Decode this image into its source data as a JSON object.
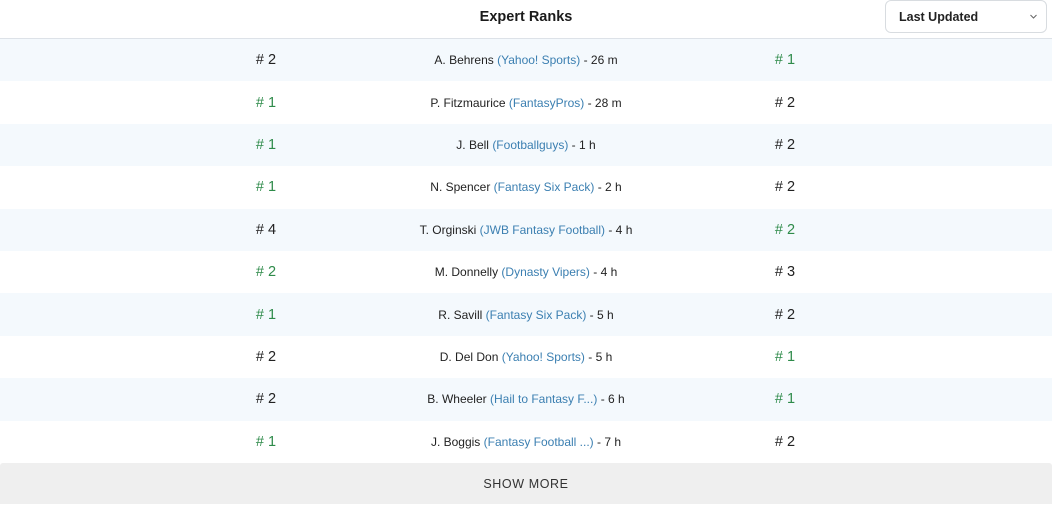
{
  "header": {
    "title": "Expert Ranks",
    "sort_select": {
      "selected": "Last Updated"
    }
  },
  "colors": {
    "accent_green": "#2e8b4a",
    "link_blue": "#3b7fb1",
    "row_alt": "#f4f9fd"
  },
  "rows": [
    {
      "left_rank": "# 2",
      "left_best": false,
      "expert": "A. Behrens",
      "source": "(Yahoo! Sports)",
      "time": " - 26 m",
      "right_rank": "# 1",
      "right_best": true
    },
    {
      "left_rank": "# 1",
      "left_best": true,
      "expert": "P. Fitzmaurice",
      "source": "(FantasyPros)",
      "time": " - 28 m",
      "right_rank": "# 2",
      "right_best": false
    },
    {
      "left_rank": "# 1",
      "left_best": true,
      "expert": "J. Bell",
      "source": "(Footballguys)",
      "time": " - 1 h",
      "right_rank": "# 2",
      "right_best": false
    },
    {
      "left_rank": "# 1",
      "left_best": true,
      "expert": "N. Spencer",
      "source": "(Fantasy Six Pack)",
      "time": " - 2 h",
      "right_rank": "# 2",
      "right_best": false
    },
    {
      "left_rank": "# 4",
      "left_best": false,
      "expert": "T. Orginski",
      "source": "(JWB Fantasy Football)",
      "time": " - 4 h",
      "right_rank": "# 2",
      "right_best": true
    },
    {
      "left_rank": "# 2",
      "left_best": true,
      "expert": "M. Donnelly",
      "source": "(Dynasty Vipers)",
      "time": " - 4 h",
      "right_rank": "# 3",
      "right_best": false
    },
    {
      "left_rank": "# 1",
      "left_best": true,
      "expert": "R. Savill",
      "source": "(Fantasy Six Pack)",
      "time": " - 5 h",
      "right_rank": "# 2",
      "right_best": false
    },
    {
      "left_rank": "# 2",
      "left_best": false,
      "expert": "D. Del Don",
      "source": "(Yahoo! Sports)",
      "time": " - 5 h",
      "right_rank": "# 1",
      "right_best": true
    },
    {
      "left_rank": "# 2",
      "left_best": false,
      "expert": "B. Wheeler",
      "source": "(Hail to Fantasy F...)",
      "time": " - 6 h",
      "right_rank": "# 1",
      "right_best": true
    },
    {
      "left_rank": "# 1",
      "left_best": true,
      "expert": "J. Boggis",
      "source": "(Fantasy Football ...)",
      "time": " - 7 h",
      "right_rank": "# 2",
      "right_best": false
    }
  ],
  "show_more_label": "SHOW MORE"
}
